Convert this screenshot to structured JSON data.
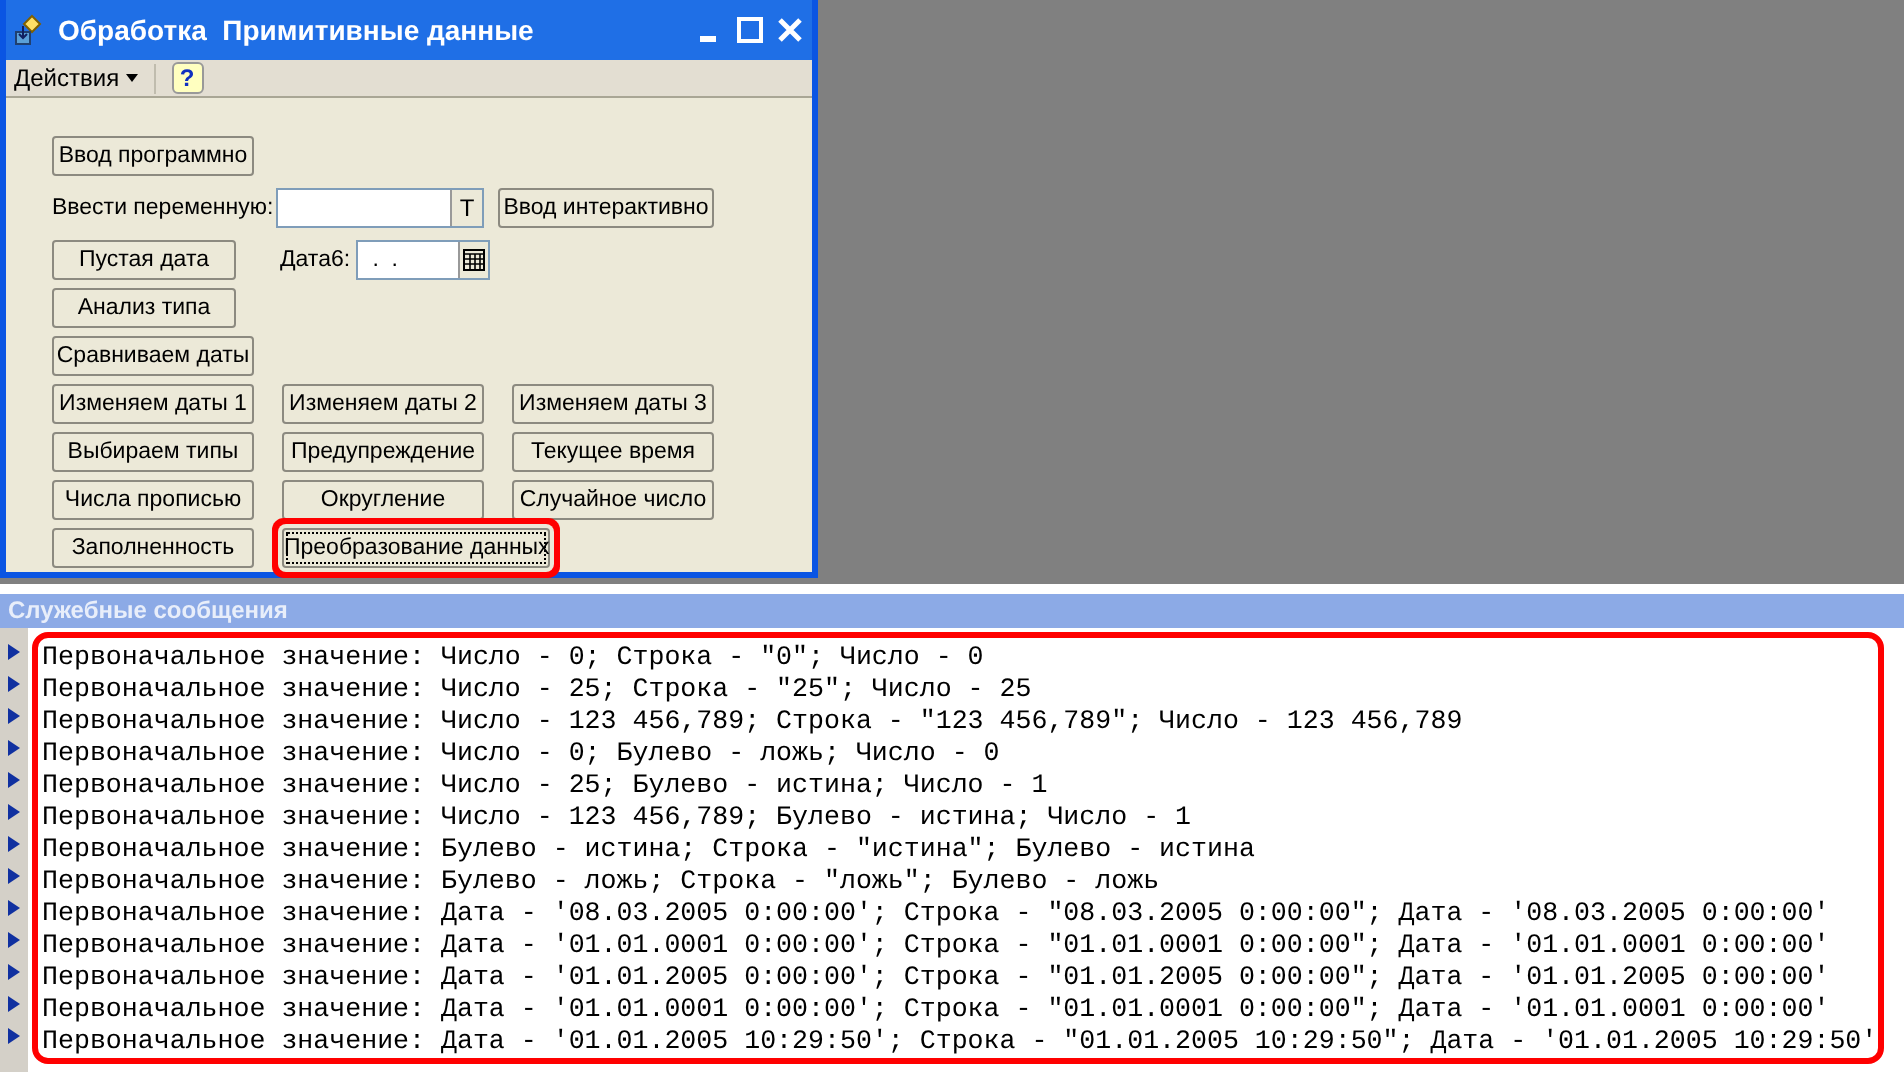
{
  "window": {
    "title": "Обработка  Примитивные данные"
  },
  "toolbar": {
    "actions_menu": "Действия",
    "help": "?"
  },
  "form": {
    "rows": [
      [
        {
          "kind": "button",
          "label": "Ввод программно",
          "highlighted": false
        }
      ],
      [
        {
          "kind": "label",
          "label": "Ввести переменную:"
        },
        {
          "kind": "text-field",
          "button": "T"
        },
        {
          "kind": "button",
          "label": "Ввод интерактивно",
          "highlighted": false
        }
      ],
      [
        {
          "kind": "button",
          "label": "Пустая дата",
          "highlighted": false
        },
        {
          "kind": "date-field",
          "label": "Дата6:",
          "value": " .  ."
        }
      ],
      [
        {
          "kind": "button",
          "label": "Анализ типа",
          "highlighted": false
        }
      ],
      [
        {
          "kind": "button",
          "label": "Сравниваем даты",
          "highlighted": false
        }
      ],
      [
        {
          "kind": "button",
          "label": "Изменяем даты 1",
          "highlighted": false
        },
        {
          "kind": "button",
          "label": "Изменяем даты 2",
          "highlighted": false
        },
        {
          "kind": "button",
          "label": "Изменяем даты 3",
          "highlighted": false
        }
      ],
      [
        {
          "kind": "button",
          "label": "Выбираем типы",
          "highlighted": false
        },
        {
          "kind": "button",
          "label": "Предупреждение",
          "highlighted": false
        },
        {
          "kind": "button",
          "label": "Текущее время",
          "highlighted": false
        }
      ],
      [
        {
          "kind": "button",
          "label": "Числа прописью",
          "highlighted": false
        },
        {
          "kind": "button",
          "label": "Округление",
          "highlighted": false
        },
        {
          "kind": "button",
          "label": "Случайное число",
          "highlighted": false
        }
      ],
      [
        {
          "kind": "button",
          "label": "Заполненность",
          "highlighted": false
        },
        {
          "kind": "button",
          "label": "Преобразование данных",
          "highlighted": true
        }
      ]
    ]
  },
  "messages": {
    "title": "Служебные сообщения",
    "highlighted": true,
    "lines": [
      "Первоначальное значение: Число - 0; Строка - \"0\"; Число - 0",
      "Первоначальное значение: Число - 25; Строка - \"25\"; Число - 25",
      "Первоначальное значение: Число - 123 456,789; Строка - \"123 456,789\"; Число - 123 456,789",
      "Первоначальное значение: Число - 0; Булево - ложь; Число - 0",
      "Первоначальное значение: Число - 25; Булево - истина; Число - 1",
      "Первоначальное значение: Число - 123 456,789; Булево - истина; Число - 1",
      "Первоначальное значение: Булево - истина; Строка - \"истина\"; Булево - истина",
      "Первоначальное значение: Булево - ложь; Строка - \"ложь\"; Булево - ложь",
      "Первоначальное значение: Дата - '08.03.2005 0:00:00'; Строка - \"08.03.2005 0:00:00\"; Дата - '08.03.2005 0:00:00'",
      "Первоначальное значение: Дата - '01.01.0001 0:00:00'; Строка - \"01.01.0001 0:00:00\"; Дата - '01.01.0001 0:00:00'",
      "Первоначальное значение: Дата - '01.01.2005 0:00:00'; Строка - \"01.01.2005 0:00:00\"; Дата - '01.01.2005 0:00:00'",
      "Первоначальное значение: Дата - '01.01.0001 0:00:00'; Строка - \"01.01.0001 0:00:00\"; Дата - '01.01.0001 0:00:00'",
      "Первоначальное значение: Дата - '01.01.2005 10:29:50'; Строка - \"01.01.2005 10:29:50\"; Дата - '01.01.2005 10:29:50'"
    ]
  }
}
